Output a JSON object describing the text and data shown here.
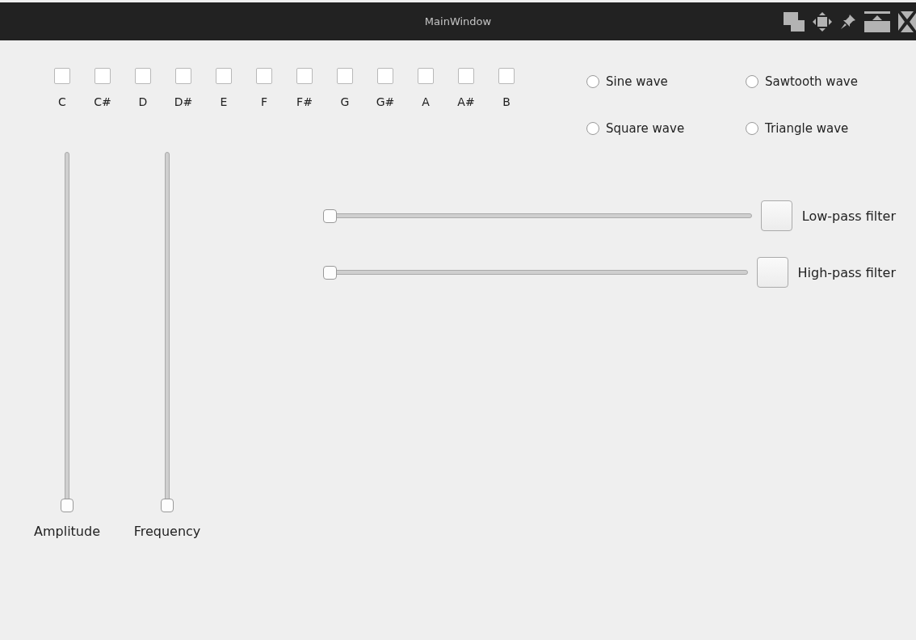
{
  "window": {
    "title": "MainWindow"
  },
  "notes": [
    {
      "label": "C",
      "checked": false
    },
    {
      "label": "C#",
      "checked": false
    },
    {
      "label": "D",
      "checked": false
    },
    {
      "label": "D#",
      "checked": false
    },
    {
      "label": "E",
      "checked": false
    },
    {
      "label": "F",
      "checked": false
    },
    {
      "label": "F#",
      "checked": false
    },
    {
      "label": "G",
      "checked": false
    },
    {
      "label": "G#",
      "checked": false
    },
    {
      "label": "A",
      "checked": false
    },
    {
      "label": "A#",
      "checked": false
    },
    {
      "label": "B",
      "checked": false
    }
  ],
  "waveforms": [
    {
      "label": "Sine wave",
      "selected": false
    },
    {
      "label": "Sawtooth wave",
      "selected": false
    },
    {
      "label": "Square wave",
      "selected": false
    },
    {
      "label": "Triangle wave",
      "selected": false
    }
  ],
  "vertical_sliders": [
    {
      "label": "Amplitude",
      "level": 0
    },
    {
      "label": "Frequency",
      "level": 0
    }
  ],
  "filters": [
    {
      "label": "Low-pass filter",
      "level": 0
    },
    {
      "label": "High-pass filter",
      "level": 0
    }
  ]
}
